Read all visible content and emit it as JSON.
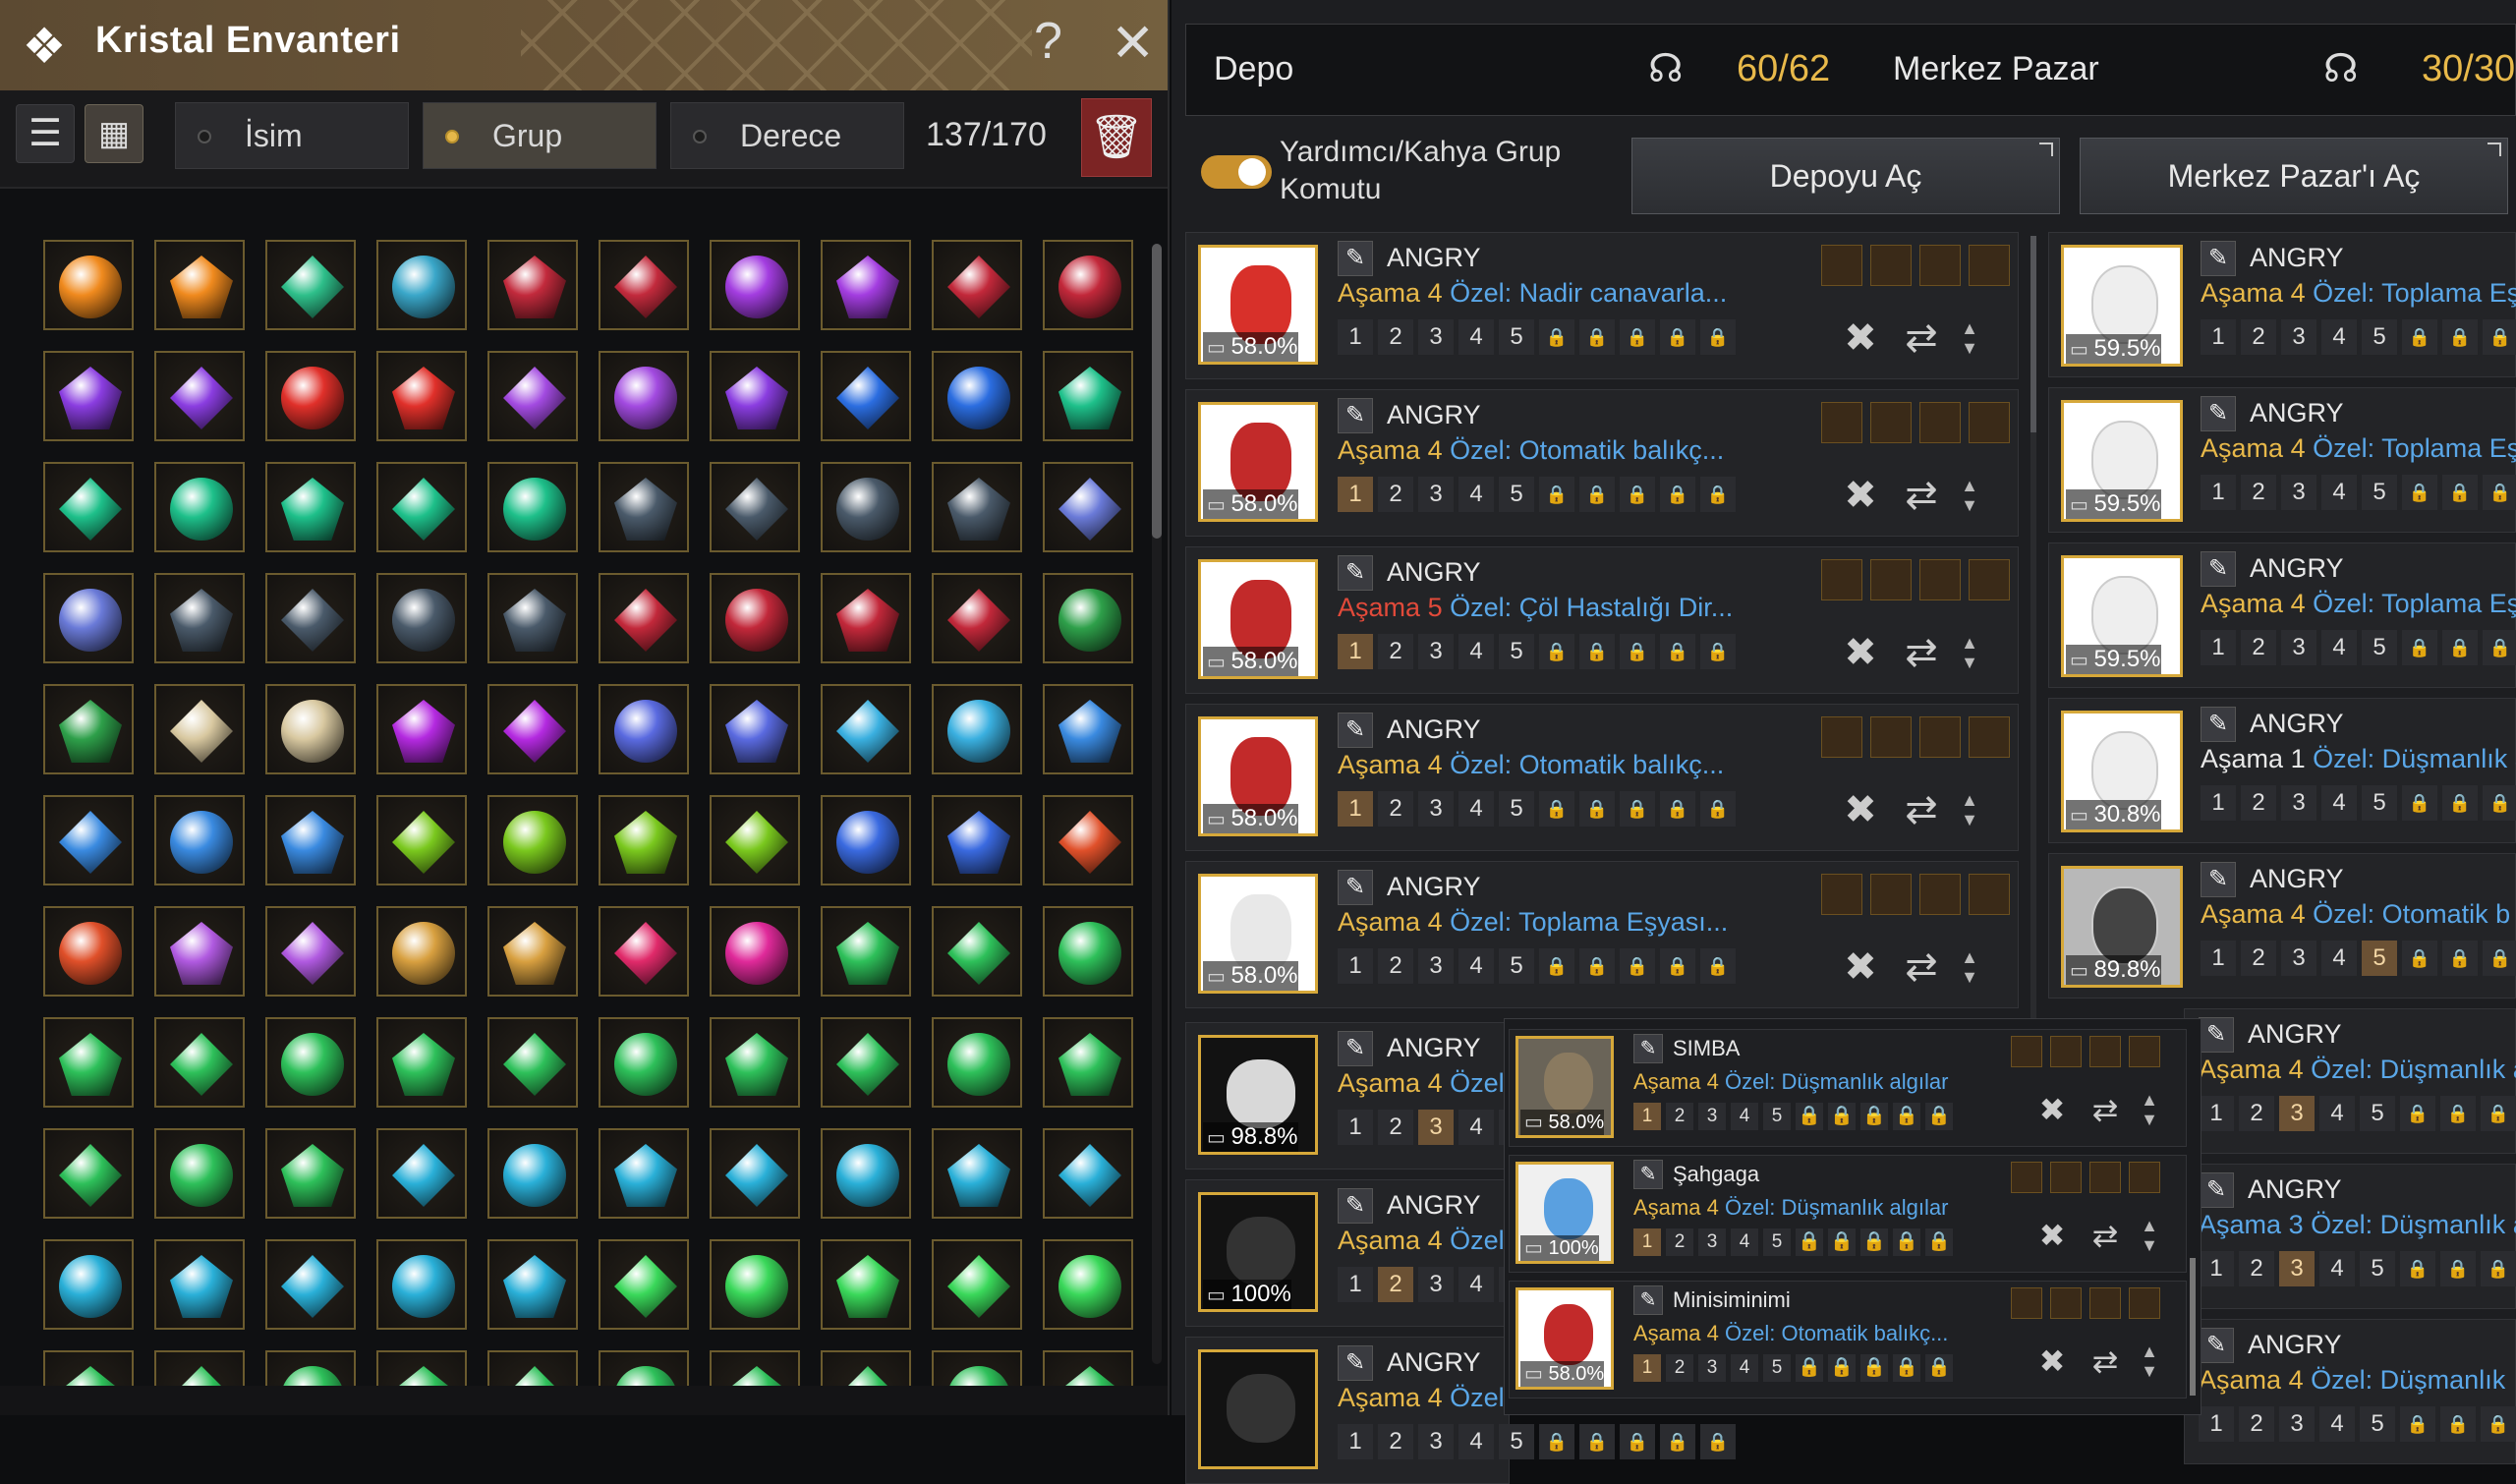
{
  "left": {
    "title": "Kristal Envanteri",
    "help_label": "?",
    "close_label": "✕",
    "filters": [
      "İsim",
      "Grup",
      "Derece"
    ],
    "selected_filter": "Grup",
    "count": "137/170",
    "rows": [
      [
        "#f08a1e",
        "#f08a1e",
        "#2ebf8a",
        "#3aa7c9",
        "#c22a3c",
        "#c22a3c",
        "#a33de0",
        "#a33de0",
        "#c2283a",
        "#c2283a"
      ],
      [
        "#8a3de0",
        "#8a3de0",
        "#e0302a",
        "#e0302a",
        "#a24ae0",
        "#a24ae0",
        "#8a3de0",
        "#2b6de0",
        "#2b6de0",
        "#1ec08a"
      ],
      [
        "#1ec08a",
        "#1ec08a",
        "#1ec08a",
        "#1ec08a",
        "#1ec08a",
        "#4a5a6a",
        "#4a5a6a",
        "#4a5a6a",
        "#4a5a6a",
        "#6a7ad8"
      ],
      [
        "#6a7ad8",
        "#4a5a6a",
        "#4a5a6a",
        "#4a5a6a",
        "#4a5a6a",
        "#c2283a",
        "#c2283a",
        "#c2283a",
        "#c2283a",
        "#2ea04a"
      ],
      [
        "#2ea04a",
        "#d8c8a0",
        "#d8c8a0",
        "#b42ae0",
        "#b42ae0",
        "#5a6ae0",
        "#5a6ae0",
        "#3ab0e0",
        "#3ab0e0",
        "#3a8ae0"
      ],
      [
        "#3a8ae0",
        "#3a8ae0",
        "#3a8ae0",
        "#7ac81e",
        "#7ac81e",
        "#7ac81e",
        "#7ac81e",
        "#3a6ae0",
        "#3a6ae0",
        "#e0502a"
      ],
      [
        "#e0502a",
        "#b05ae0",
        "#b05ae0",
        "#d8a040",
        "#d8a040",
        "#e02a6a",
        "#e02a9a",
        "#2ec05a",
        "#2ec05a",
        "#2ec05a"
      ],
      [
        "#2ec05a",
        "#2ec05a",
        "#2ec05a",
        "#2ec05a",
        "#2ec05a",
        "#2ec05a",
        "#2ec05a",
        "#2ec05a",
        "#2ec05a",
        "#2ec05a"
      ],
      [
        "#2ec05a",
        "#2ec05a",
        "#2ec05a",
        "#2ab0d8",
        "#2ab0d8",
        "#2ab0d8",
        "#2ab0d8",
        "#2ab0d8",
        "#2ab0d8",
        "#2ab0d8"
      ],
      [
        "#2ab0d8",
        "#2ab0d8",
        "#2ab0d8",
        "#2ab0d8",
        "#2ab0d8",
        "#3ad85a",
        "#3ad85a",
        "#3ad85a",
        "#3ad85a",
        "#3ad85a"
      ],
      [
        "#2ec05a",
        "#2ec05a",
        "#2ec05a",
        "#2ec05a",
        "#2ec05a",
        "#2ec05a",
        "#2ec05a",
        "#2ec05a",
        "#2ec05a",
        "#2ec05a"
      ]
    ]
  },
  "right": {
    "depo": {
      "label": "Depo",
      "count": "60/62"
    },
    "pazar": {
      "label": "Merkez Pazar",
      "count": "30/30"
    },
    "toggle_label": "Yardımcı/Kahya Grup Komutu",
    "open_depo": "Depoyu Aç",
    "open_pazar": "Merkez Pazar'ı Aç",
    "stage_word": "Aşama",
    "special_word": "Özel:",
    "pets_left": [
      {
        "name": "ANGRY",
        "stage": "4",
        "special": "Nadir canavarla...",
        "pct": "58.0%",
        "img": "#d8302a",
        "bg": "white",
        "on": -1,
        "stagecls": ""
      },
      {
        "name": "ANGRY",
        "stage": "4",
        "special": "Otomatik balıkç...",
        "pct": "58.0%",
        "img": "#c22a2a",
        "bg": "white",
        "on": 0,
        "stagecls": ""
      },
      {
        "name": "ANGRY",
        "stage": "5",
        "special": "Çöl Hastalığı Dir...",
        "pct": "58.0%",
        "img": "#c22a2a",
        "bg": "white",
        "on": 0,
        "stagecls": "red"
      },
      {
        "name": "ANGRY",
        "stage": "4",
        "special": "Otomatik balıkç...",
        "pct": "58.0%",
        "img": "#c22a2a",
        "bg": "white",
        "on": 0,
        "stagecls": ""
      },
      {
        "name": "ANGRY",
        "stage": "4",
        "special": "Toplama Eşyası...",
        "pct": "58.0%",
        "img": "#e8e8e8",
        "bg": "white",
        "on": -1,
        "stagecls": ""
      }
    ],
    "pets_left_partial": [
      {
        "name": "ANGRY",
        "stage": "4",
        "special": "Özel",
        "pct": "98.8%",
        "on": 2
      },
      {
        "name": "ANGRY",
        "stage": "4",
        "special": "Özel",
        "pct": "100%",
        "on": 1
      },
      {
        "name": "ANGRY",
        "stage": "4",
        "special": "Özel",
        "pct": "",
        "on": -1
      }
    ],
    "pets_right": [
      {
        "name": "ANGRY",
        "stage": "4",
        "special": "Toplama Eş",
        "pct": "59.5%",
        "on": -1,
        "stagecls": "",
        "bg": "white"
      },
      {
        "name": "ANGRY",
        "stage": "4",
        "special": "Toplama Eş",
        "pct": "59.5%",
        "on": -1,
        "stagecls": "",
        "bg": "white"
      },
      {
        "name": "ANGRY",
        "stage": "4",
        "special": "Toplama Eş",
        "pct": "59.5%",
        "on": -1,
        "stagecls": "",
        "bg": "white"
      },
      {
        "name": "ANGRY",
        "stage": "1",
        "special": "Düşmanlık a",
        "pct": "30.8%",
        "on": -1,
        "stagecls": "white",
        "bg": "white"
      },
      {
        "name": "ANGRY",
        "stage": "4",
        "special": "Otomatik b",
        "pct": "89.8%",
        "on": 4,
        "stagecls": "",
        "bg": "grey"
      },
      {
        "name": "ANGRY",
        "stage": "4",
        "special": "Düşmanlık a",
        "pct": "",
        "on": 2,
        "stagecls": "",
        "bg": "none"
      },
      {
        "name": "ANGRY",
        "stage": "3",
        "special": "Düşmanlık a",
        "pct": "",
        "on": 2,
        "stagecls": "blue",
        "bg": "none"
      },
      {
        "name": "ANGRY",
        "stage": "4",
        "special": "Düşmanlık",
        "pct": "",
        "on": -1,
        "stagecls": "",
        "bg": "none"
      }
    ],
    "popup": [
      {
        "name": "SIMBA",
        "stage": "4",
        "special": "Düşmanlık algılar",
        "pct": "58.0%"
      },
      {
        "name": "Şahgaga",
        "stage": "4",
        "special": "Düşmanlık algılar",
        "pct": "100%"
      },
      {
        "name": "Minisiminimi",
        "stage": "4",
        "special": "Otomatik balıkç...",
        "pct": "58.0%"
      }
    ]
  }
}
